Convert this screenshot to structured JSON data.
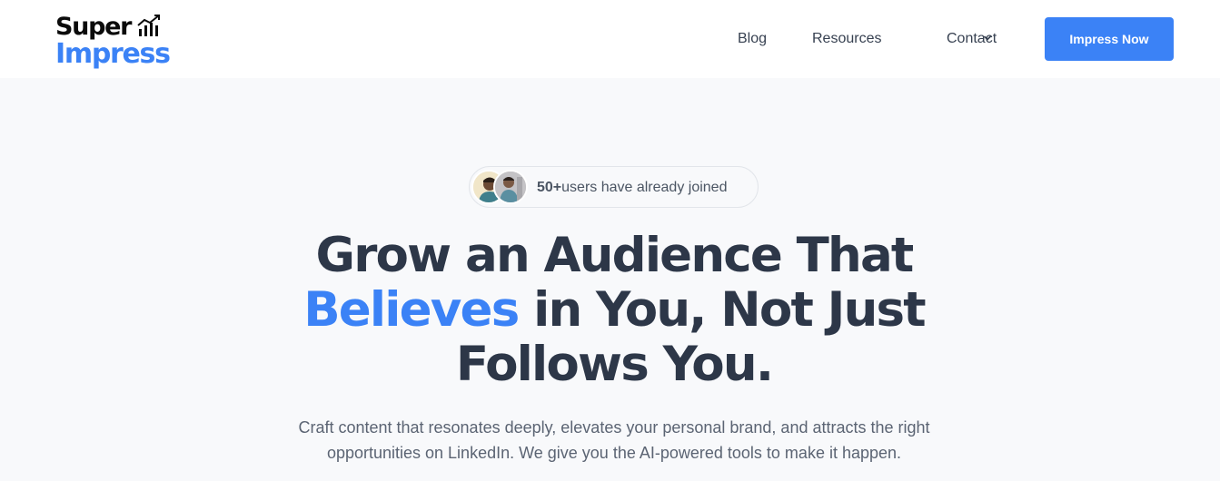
{
  "brand": {
    "name_top": "Super",
    "name_bottom": "Impress",
    "logo_icon": "bar-chart-trend-icon",
    "accent_color": "#3b82f6"
  },
  "nav": {
    "items": [
      {
        "label": "Blog"
      },
      {
        "label": "Resources",
        "icon": "chevron-down-icon"
      },
      {
        "label": "Contact"
      }
    ],
    "cta_label": "Impress Now"
  },
  "hero": {
    "social_proof": {
      "count": "50+",
      "text": "users have already joined"
    },
    "headline": {
      "line1": "Grow an Audience That",
      "accent": "Believes",
      "line2_rest": " in You, Not Just",
      "line3": "Follows You."
    },
    "subtext_line1": "Craft content that resonates deeply, elevates your personal brand, and attracts the right",
    "subtext_line2": "opportunities on LinkedIn. We give you the AI-powered tools to make it happen."
  }
}
